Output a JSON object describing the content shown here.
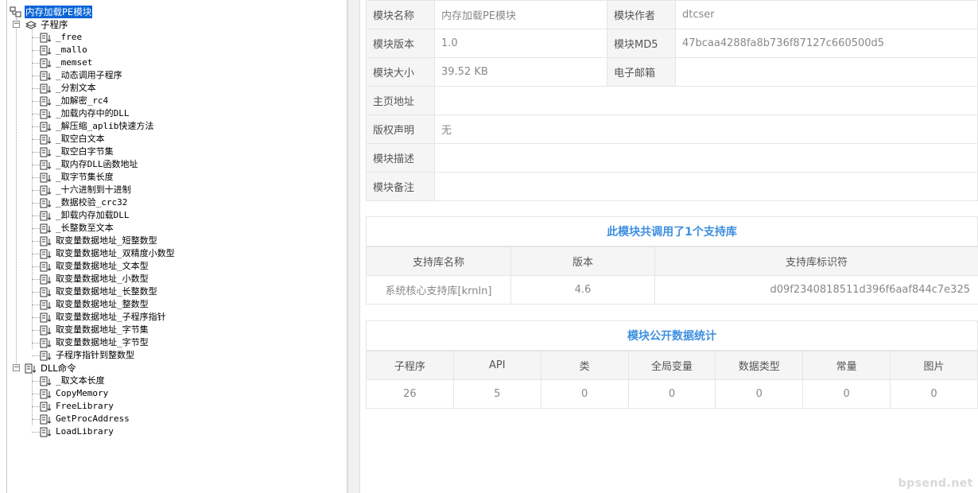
{
  "tree": {
    "root": {
      "label": "内存加载PE模块"
    },
    "group_subprograms": {
      "label": "子程序"
    },
    "subprograms": [
      "_free",
      "_mallo",
      "_memset",
      "_动态调用子程序",
      "_分割文本",
      "_加解密_rc4",
      "_加载内存中的DLL",
      "_解压缩_aplib快速方法",
      "_取空白文本",
      "_取空白字节集",
      "_取内存DLL函数地址",
      "_取字节集长度",
      "_十六进制到十进制",
      "_数据校验_crc32",
      "_卸载内存加载DLL",
      "_长整数至文本",
      "取变量数据地址_短整数型",
      "取变量数据地址_双精度小数型",
      "取变量数据地址_文本型",
      "取变量数据地址_小数型",
      "取变量数据地址_长整数型",
      "取变量数据地址_整数型",
      "取变量数据地址_子程序指针",
      "取变量数据地址_字节集",
      "取变量数据地址_字节型",
      "子程序指针到整数型"
    ],
    "group_dll": {
      "label": "DLL命令"
    },
    "dll_commands": [
      "_取文本长度",
      "CopyMemory",
      "FreeLibrary",
      "GetProcAddress",
      "LoadLibrary"
    ]
  },
  "module_info": {
    "rows": [
      [
        {
          "k": "模块名称",
          "v": "内存加载PE模块"
        },
        {
          "k": "模块作者",
          "v": "dtcser"
        }
      ],
      [
        {
          "k": "模块版本",
          "v": "1.0"
        },
        {
          "k": "模块MD5",
          "v": "47bcaa4288fa8b736f87127c660500d5"
        }
      ],
      [
        {
          "k": "模块大小",
          "v": "39.52 KB"
        },
        {
          "k": "电子邮箱",
          "v": ""
        }
      ]
    ],
    "full_rows": [
      {
        "k": "主页地址",
        "v": ""
      },
      {
        "k": "版权声明",
        "v": "无"
      },
      {
        "k": "模块描述",
        "v": ""
      },
      {
        "k": "模块备注",
        "v": ""
      }
    ]
  },
  "support_libs": {
    "title": "此模块共调用了1个支持库",
    "headers": [
      "支持库名称",
      "版本",
      "支持库标识符"
    ],
    "rows": [
      [
        "系统核心支持库[krnln]",
        "4.6",
        "d09f2340818511d396f6aaf844c7e325"
      ]
    ]
  },
  "stats": {
    "title": "模块公开数据统计",
    "headers": [
      "子程序",
      "API",
      "类",
      "全局变量",
      "数据类型",
      "常量",
      "图片"
    ],
    "values": [
      "26",
      "5",
      "0",
      "0",
      "0",
      "0",
      "0"
    ]
  },
  "watermark": "bpsend.net",
  "colors": {
    "accent": "#3d8fe0",
    "selection": "#0a64d8"
  }
}
